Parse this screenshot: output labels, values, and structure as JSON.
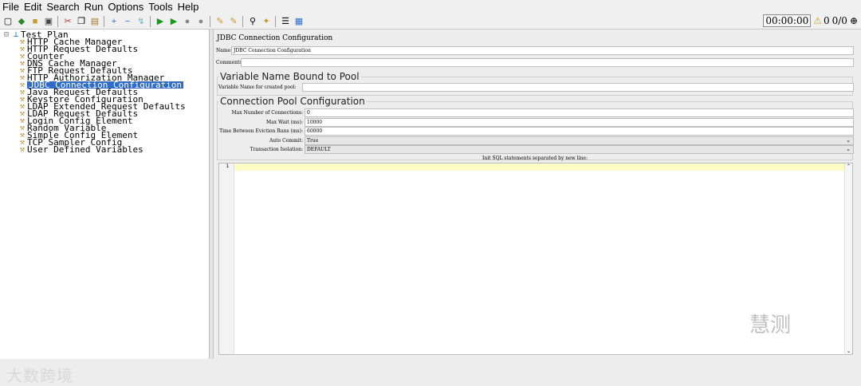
{
  "menu": [
    "File",
    "Edit",
    "Search",
    "Run",
    "Options",
    "Tools",
    "Help"
  ],
  "timer": {
    "elapsed": "00:00:00",
    "warn_count": "0",
    "threads": "0/0"
  },
  "tree": {
    "root": "Test Plan",
    "items": [
      "HTTP Cache Manager",
      "HTTP Request Defaults",
      "Counter",
      "DNS Cache Manager",
      "FTP Request Defaults",
      "HTTP Authorization Manager",
      "JDBC Connection Configuration",
      "Java Request Defaults",
      "Keystore Configuration",
      "LDAP Extended Request Defaults",
      "LDAP Request Defaults",
      "Login Config Element",
      "Random Variable",
      "Simple Config Element",
      "TCP Sampler Config",
      "User Defined Variables"
    ],
    "selected_index": 6
  },
  "panel": {
    "title": "JDBC Connection Configuration",
    "name_label": "Name:",
    "name_value": "JDBC Connection Configuration",
    "comments_label": "Comments:",
    "group1_title": "Variable Name Bound to Pool",
    "var_label": "Variable Name for created pool:",
    "group2_title": "Connection Pool Configuration",
    "max_conn_label": "Max Number of Connections:",
    "max_conn_value": "0",
    "max_wait_label": "Max Wait (ms):",
    "max_wait_value": "10000",
    "eviction_label": "Time Between Eviction Runs (ms):",
    "eviction_value": "60000",
    "auto_commit_label": "Auto Commit:",
    "auto_commit_value": "True",
    "isolation_label": "Transaction Isolation:",
    "isolation_value": "DEFAULT",
    "init_sql_label": "Init SQL statements separated by new line:",
    "line_number": "1"
  },
  "watermarks": {
    "left": "大数跨境",
    "right": "慧测"
  }
}
